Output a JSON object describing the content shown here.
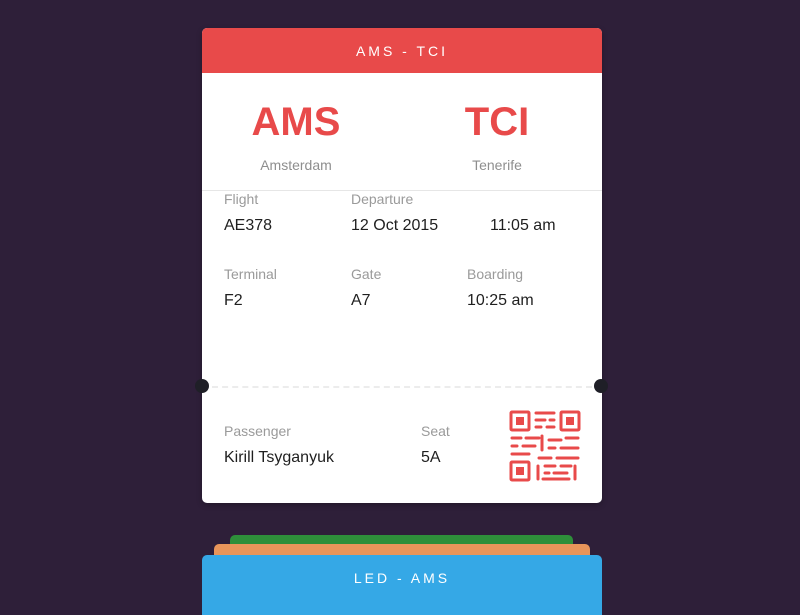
{
  "ticket": {
    "header": "AMS - TCI",
    "from": {
      "code": "AMS",
      "city": "Amsterdam"
    },
    "to": {
      "code": "TCI",
      "city": "Tenerife"
    },
    "flight": {
      "label": "Flight",
      "value": "AE378"
    },
    "departure": {
      "label": "Departure",
      "date": "12 Oct 2015",
      "time": "11:05 am"
    },
    "terminal": {
      "label": "Terminal",
      "value": "F2"
    },
    "gate": {
      "label": "Gate",
      "value": "A7"
    },
    "boarding": {
      "label": "Boarding",
      "value": "10:25 am"
    },
    "passenger": {
      "label": "Passenger",
      "value": "Kirill Tsyganyuk"
    },
    "seat": {
      "label": "Seat",
      "value": "5A"
    },
    "qr_icon": "qr-code-icon"
  },
  "stack": {
    "next_ticket_label": "LED - AMS"
  },
  "colors": {
    "background": "#2e1f39",
    "accent_red": "#e84a4a",
    "card_blue": "#35a8e6",
    "card_orange": "#e8955a",
    "card_green": "#2e8f3a"
  }
}
